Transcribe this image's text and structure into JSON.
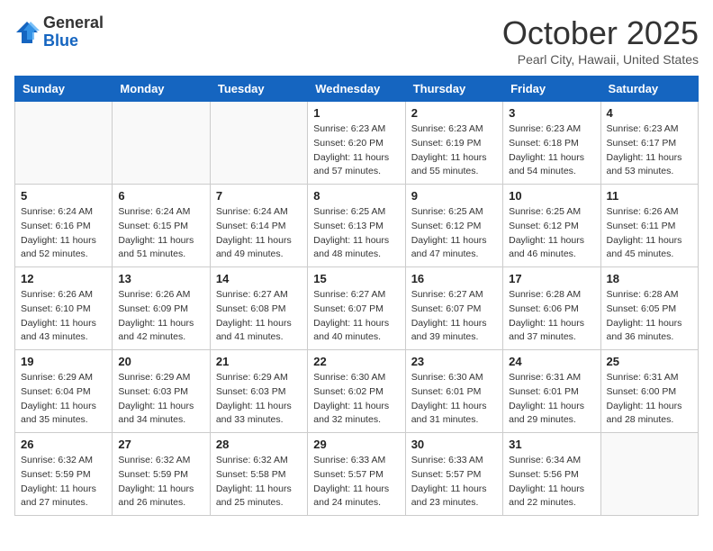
{
  "header": {
    "logo_general": "General",
    "logo_blue": "Blue",
    "month_title": "October 2025",
    "subtitle": "Pearl City, Hawaii, United States"
  },
  "weekdays": [
    "Sunday",
    "Monday",
    "Tuesday",
    "Wednesday",
    "Thursday",
    "Friday",
    "Saturday"
  ],
  "weeks": [
    [
      {
        "day": "",
        "info": ""
      },
      {
        "day": "",
        "info": ""
      },
      {
        "day": "",
        "info": ""
      },
      {
        "day": "1",
        "info": "Sunrise: 6:23 AM\nSunset: 6:20 PM\nDaylight: 11 hours and 57 minutes."
      },
      {
        "day": "2",
        "info": "Sunrise: 6:23 AM\nSunset: 6:19 PM\nDaylight: 11 hours and 55 minutes."
      },
      {
        "day": "3",
        "info": "Sunrise: 6:23 AM\nSunset: 6:18 PM\nDaylight: 11 hours and 54 minutes."
      },
      {
        "day": "4",
        "info": "Sunrise: 6:23 AM\nSunset: 6:17 PM\nDaylight: 11 hours and 53 minutes."
      }
    ],
    [
      {
        "day": "5",
        "info": "Sunrise: 6:24 AM\nSunset: 6:16 PM\nDaylight: 11 hours and 52 minutes."
      },
      {
        "day": "6",
        "info": "Sunrise: 6:24 AM\nSunset: 6:15 PM\nDaylight: 11 hours and 51 minutes."
      },
      {
        "day": "7",
        "info": "Sunrise: 6:24 AM\nSunset: 6:14 PM\nDaylight: 11 hours and 49 minutes."
      },
      {
        "day": "8",
        "info": "Sunrise: 6:25 AM\nSunset: 6:13 PM\nDaylight: 11 hours and 48 minutes."
      },
      {
        "day": "9",
        "info": "Sunrise: 6:25 AM\nSunset: 6:12 PM\nDaylight: 11 hours and 47 minutes."
      },
      {
        "day": "10",
        "info": "Sunrise: 6:25 AM\nSunset: 6:12 PM\nDaylight: 11 hours and 46 minutes."
      },
      {
        "day": "11",
        "info": "Sunrise: 6:26 AM\nSunset: 6:11 PM\nDaylight: 11 hours and 45 minutes."
      }
    ],
    [
      {
        "day": "12",
        "info": "Sunrise: 6:26 AM\nSunset: 6:10 PM\nDaylight: 11 hours and 43 minutes."
      },
      {
        "day": "13",
        "info": "Sunrise: 6:26 AM\nSunset: 6:09 PM\nDaylight: 11 hours and 42 minutes."
      },
      {
        "day": "14",
        "info": "Sunrise: 6:27 AM\nSunset: 6:08 PM\nDaylight: 11 hours and 41 minutes."
      },
      {
        "day": "15",
        "info": "Sunrise: 6:27 AM\nSunset: 6:07 PM\nDaylight: 11 hours and 40 minutes."
      },
      {
        "day": "16",
        "info": "Sunrise: 6:27 AM\nSunset: 6:07 PM\nDaylight: 11 hours and 39 minutes."
      },
      {
        "day": "17",
        "info": "Sunrise: 6:28 AM\nSunset: 6:06 PM\nDaylight: 11 hours and 37 minutes."
      },
      {
        "day": "18",
        "info": "Sunrise: 6:28 AM\nSunset: 6:05 PM\nDaylight: 11 hours and 36 minutes."
      }
    ],
    [
      {
        "day": "19",
        "info": "Sunrise: 6:29 AM\nSunset: 6:04 PM\nDaylight: 11 hours and 35 minutes."
      },
      {
        "day": "20",
        "info": "Sunrise: 6:29 AM\nSunset: 6:03 PM\nDaylight: 11 hours and 34 minutes."
      },
      {
        "day": "21",
        "info": "Sunrise: 6:29 AM\nSunset: 6:03 PM\nDaylight: 11 hours and 33 minutes."
      },
      {
        "day": "22",
        "info": "Sunrise: 6:30 AM\nSunset: 6:02 PM\nDaylight: 11 hours and 32 minutes."
      },
      {
        "day": "23",
        "info": "Sunrise: 6:30 AM\nSunset: 6:01 PM\nDaylight: 11 hours and 31 minutes."
      },
      {
        "day": "24",
        "info": "Sunrise: 6:31 AM\nSunset: 6:01 PM\nDaylight: 11 hours and 29 minutes."
      },
      {
        "day": "25",
        "info": "Sunrise: 6:31 AM\nSunset: 6:00 PM\nDaylight: 11 hours and 28 minutes."
      }
    ],
    [
      {
        "day": "26",
        "info": "Sunrise: 6:32 AM\nSunset: 5:59 PM\nDaylight: 11 hours and 27 minutes."
      },
      {
        "day": "27",
        "info": "Sunrise: 6:32 AM\nSunset: 5:59 PM\nDaylight: 11 hours and 26 minutes."
      },
      {
        "day": "28",
        "info": "Sunrise: 6:32 AM\nSunset: 5:58 PM\nDaylight: 11 hours and 25 minutes."
      },
      {
        "day": "29",
        "info": "Sunrise: 6:33 AM\nSunset: 5:57 PM\nDaylight: 11 hours and 24 minutes."
      },
      {
        "day": "30",
        "info": "Sunrise: 6:33 AM\nSunset: 5:57 PM\nDaylight: 11 hours and 23 minutes."
      },
      {
        "day": "31",
        "info": "Sunrise: 6:34 AM\nSunset: 5:56 PM\nDaylight: 11 hours and 22 minutes."
      },
      {
        "day": "",
        "info": ""
      }
    ]
  ]
}
